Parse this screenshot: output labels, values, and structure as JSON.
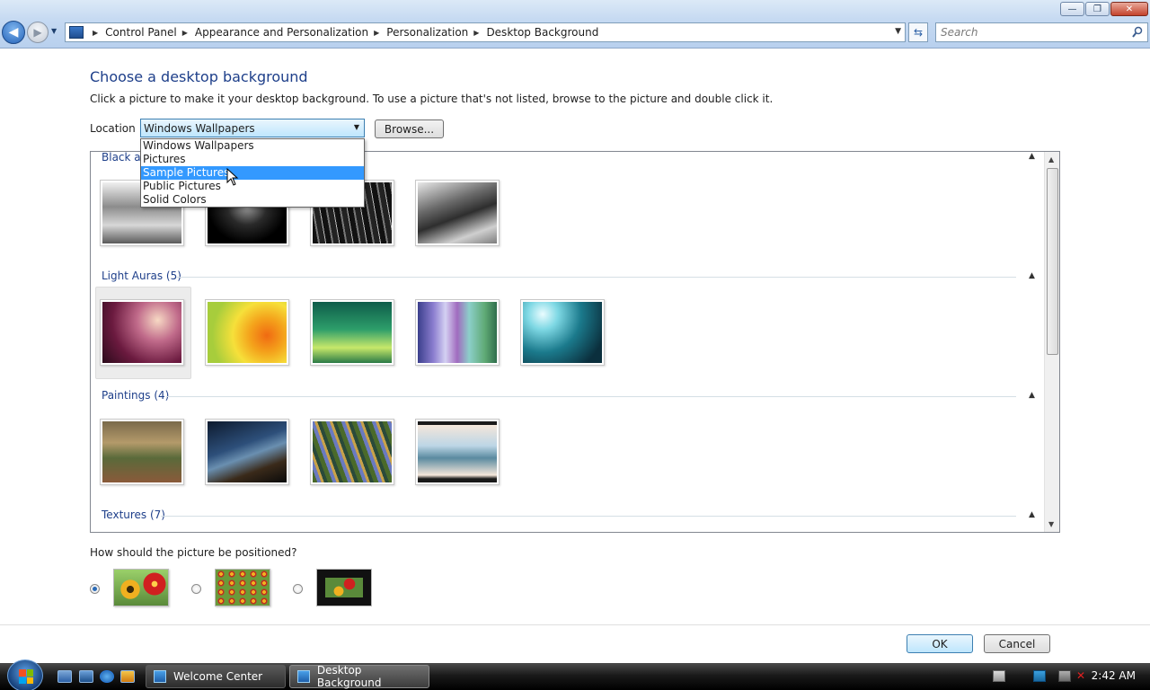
{
  "window": {
    "minimize": "—",
    "maximize": "❐",
    "close": "✕"
  },
  "address": {
    "crumbs": [
      "Control Panel",
      "Appearance and Personalization",
      "Personalization",
      "Desktop Background"
    ]
  },
  "search": {
    "placeholder": "Search"
  },
  "page": {
    "title": "Choose a desktop background",
    "description": "Click a picture to make it your desktop background. To use a picture that's not listed, browse to the picture and double click it.",
    "location_label": "Location",
    "location_value": "Windows Wallpapers",
    "browse_label": "Browse..."
  },
  "dropdown": {
    "options": [
      "Windows Wallpapers",
      "Pictures",
      "Sample Pictures",
      "Public Pictures",
      "Solid Colors"
    ],
    "highlighted": "Sample Pictures"
  },
  "groups": [
    {
      "label": "Black and White (4)",
      "visible_label": "Black an"
    },
    {
      "label": "Light Auras (5)"
    },
    {
      "label": "Paintings (4)"
    },
    {
      "label": "Textures (7)"
    }
  ],
  "position": {
    "question": "How should the picture be positioned?",
    "options": [
      "Fit to screen",
      "Tile",
      "Center"
    ],
    "selected": "Fit to screen"
  },
  "buttons": {
    "ok": "OK",
    "cancel": "Cancel"
  },
  "taskbar": {
    "tasks": [
      "Welcome Center",
      "Desktop Background"
    ],
    "active_task": "Desktop Background",
    "clock": "2:42 AM"
  },
  "colors": {
    "heading": "#1e3f8a",
    "highlight": "#3399ff"
  }
}
